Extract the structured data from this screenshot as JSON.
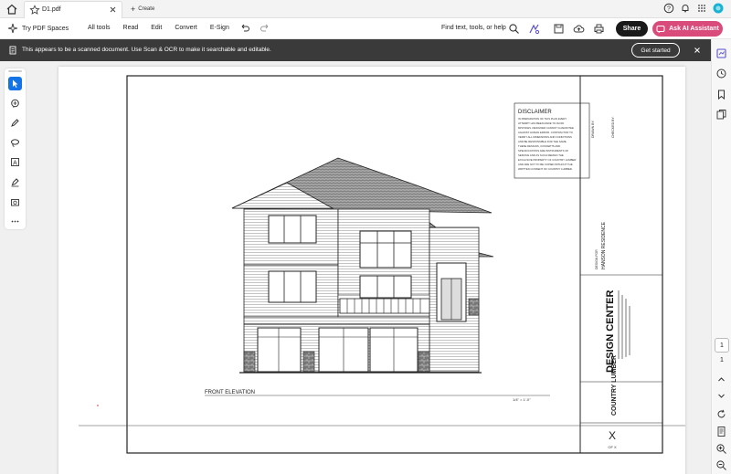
{
  "tabbar": {
    "tab_title": "D1.pdf",
    "create_label": "Create"
  },
  "toolbar": {
    "try_pdf_spaces": "Try PDF Spaces",
    "menu": [
      "All tools",
      "Read",
      "Edit",
      "Convert",
      "E-Sign"
    ],
    "find_text": "Find text, tools, or help",
    "share": "Share",
    "ask_ai": "Ask AI Assistant"
  },
  "banner": {
    "message": "This appears to be a scanned document. Use Scan & OCR to make it searchable and editable.",
    "get_started": "Get started"
  },
  "pagenav": {
    "current": "1",
    "total": "1"
  },
  "drawing": {
    "disclaimer_title": "DISCLAIMER",
    "disclaimer_lines": [
      "IN PREPARATION OF THIS PLAN EVERY",
      "ATTEMPT HAS BEEN MADE TO AVOID",
      "MISTAKES. DESIGNER CANNOT GUARANTEE",
      "AGAINST HUMAN ERROR. CONTRACTOR TO",
      "VERIFY ALL DIMENSIONS AND CONDITIONS",
      "AND BE RESPONSIBLE FOR THE SAME.",
      "THESE DESIGNS, CONCEPTS AND",
      "SPECIFICATIONS ARE INSTRUMENTS OF",
      "SERVICE AND AS SUCH REMAIN THE",
      "EXCLUSIVE PROPERTY OF COUNTRY LUMBER",
      "AND ARE NOT TO BE COPIED WITHOUT THE",
      "WRITTEN CONSENT OF COUNTRY LUMBER."
    ],
    "front_elevation": "FRONT ELEVATION",
    "scale": "1/4\" = 1'-0\"",
    "design_center": "DESIGN CENTER",
    "project": "HANSON RESIDENCE",
    "design_for": "DESIGN FOR",
    "drawn_by": "DRAWN BY:",
    "checked_by": "CHECKED BY:",
    "company": "COUNTRY LUMBER",
    "sheet": "X",
    "sheet_of": "OF X"
  }
}
